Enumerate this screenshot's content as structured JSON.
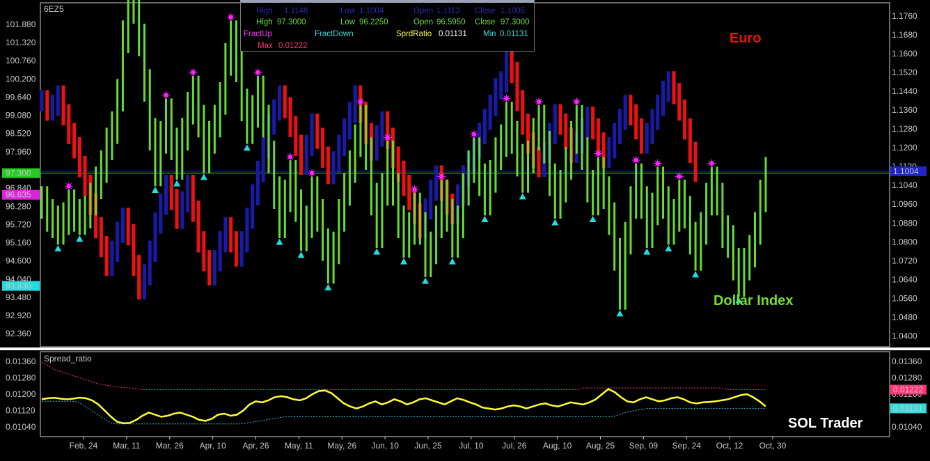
{
  "colors": {
    "background": "#000000",
    "frame": "#ffffff",
    "euro_up": "#1a1aa8",
    "euro_down": "#ee1111",
    "dx_bar": "#66dd33",
    "fract_up": "#ff22ff",
    "fract_down": "#22dddd",
    "spread_line": "#ffff33",
    "max_line": "#ff3377",
    "min_line": "#33bbdd",
    "hline_green": "#33dd33",
    "hline_blue": "#1f23c8"
  },
  "main_panel": {
    "symbol": "6EZ5",
    "series_labels": {
      "euro": "Euro",
      "dollar_index": "Dollar Index"
    },
    "left_axis_ticks": [
      "101.880",
      "101.320",
      "100.760",
      "100.200",
      "99.640",
      "99.080",
      "98.520",
      "97.960",
      "96.840",
      "96.280",
      "95.720",
      "95.160",
      "94.600",
      "94.040",
      "93.480",
      "92.920",
      "92.360"
    ],
    "right_axis_ticks": [
      "1.1760",
      "1.1680",
      "1.1600",
      "1.1520",
      "1.1440",
      "1.1360",
      "1.1280",
      "1.1200",
      "1.1120",
      "1.1040",
      "1.0960",
      "1.0880",
      "1.0800",
      "1.0720",
      "1.0640",
      "1.0560",
      "1.0480",
      "1.0400"
    ],
    "left_tags": [
      {
        "text": "97.300",
        "color": "#22cc22",
        "text_color": "#003300"
      },
      {
        "text": "96.635",
        "color": "#dd22dd",
        "text_color": "#330033"
      },
      {
        "text": "93.830",
        "color": "#22dddd",
        "text_color": "#003333"
      }
    ],
    "right_tags": [
      {
        "text": "1.1004",
        "color": "#1f23c8",
        "text_color": "#ffffff"
      }
    ]
  },
  "info_box": {
    "row1": {
      "high_label": "High",
      "high_value": "1.1148",
      "low_label": "Low",
      "low_value": "1.1004",
      "open_label": "Open",
      "open_value": "1.1113",
      "close_label": "Close",
      "close_value": "1.1005"
    },
    "row2": {
      "high_label": "High",
      "high_value": "97.3000",
      "low_label": "Low",
      "low_value": "96.2250",
      "open_label": "Open",
      "open_value": "96.5950",
      "close_label": "Close",
      "close_value": "97.3000"
    },
    "fract_up": "FractUp",
    "fract_down": "FractDown",
    "sprd_ratio_label": "SprdRatio",
    "sprd_ratio_value": "0.01131",
    "min_label": "Min",
    "min_value": "0.01131",
    "max_label": "Max",
    "max_value": "0.01222"
  },
  "lower_panel": {
    "title": "Spread_ratio",
    "left_axis_ticks": [
      "0.01360",
      "0.01280",
      "0.01200",
      "0.01120",
      "0.01040"
    ],
    "right_axis_ticks": [
      "0.01360",
      "0.01280",
      "0.01200",
      "0.01120",
      "0.01040"
    ],
    "right_tags": [
      {
        "text": "0.01222",
        "color": "#ff3377",
        "text_color": "#ffffff"
      },
      {
        "text": "0.01131",
        "color": "#33dddd",
        "text_color": "#002222"
      }
    ]
  },
  "x_axis_labels": [
    "Feb, 24",
    "Mar, 11",
    "Mar, 26",
    "Apr, 10",
    "Apr, 26",
    "May, 11",
    "May, 26",
    "Jun, 10",
    "Jun, 25",
    "Jul, 10",
    "Jul, 26",
    "Aug, 10",
    "Aug, 25",
    "Sep, 09",
    "Sep, 24",
    "Oct, 12",
    "Oct, 30"
  ],
  "watermark": "SOL Trader",
  "chart_data": [
    {
      "type": "bar",
      "title": "",
      "description_series": [
        "Euro",
        "Dollar Index"
      ],
      "ylim_left": [
        92.0,
        102.5
      ],
      "ylim_right": [
        1.036,
        1.181
      ],
      "series": [
        {
          "name": "Dollar Index",
          "values_close": [
            96.4,
            96.0,
            95.8,
            95.6,
            95.9,
            96.3,
            96.0,
            95.9,
            96.1,
            96.5,
            97.0,
            97.5,
            98.2,
            98.7,
            99.7,
            101.5,
            102.5,
            102.4,
            101.4,
            100.0,
            98.5,
            97.4,
            98.4,
            99.1,
            98.2,
            97.6,
            98.5,
            99.3,
            99.8,
            98.9,
            97.8,
            98.4,
            98.9,
            99.6,
            100.8,
            101.5,
            100.6,
            99.4,
            98.7,
            99.2,
            99.8,
            98.9,
            97.8,
            96.7,
            95.8,
            96.6,
            97.2,
            96.3,
            95.4,
            95.8,
            96.7,
            96.0,
            95.1,
            94.4,
            95.0,
            96.0,
            96.8,
            97.5,
            98.3,
            98.9,
            97.9,
            96.5,
            95.5,
            96.8,
            97.8,
            96.8,
            95.8,
            95.2,
            95.6,
            96.2,
            95.6,
            94.6,
            95.0,
            95.8,
            96.6,
            96.0,
            95.2,
            95.8,
            96.8,
            97.5,
            97.9,
            97.1,
            96.5,
            97.2,
            97.9,
            98.3,
            99.0,
            98.4,
            97.7,
            97.2,
            97.8,
            98.5,
            98.9,
            98.1,
            97.1,
            96.4,
            96.9,
            97.6,
            98.4,
            98.9,
            97.9,
            96.9,
            96.5,
            97.3,
            96.7,
            95.9,
            94.8,
            93.6,
            95.3,
            96.4,
            97.1,
            96.4,
            95.5,
            96.2,
            97.0,
            96.4,
            95.6,
            96.0,
            96.6,
            96.1,
            95.3,
            94.8,
            95.6,
            96.5,
            97.0,
            96.5,
            95.5,
            95.2,
            94.5,
            94.0,
            94.5,
            94.9,
            95.6,
            96.6,
            97.3
          ],
          "fractals_up_x": [
            "Feb, 24",
            "Mar, 11",
            "Mar, 26",
            "Apr, 10",
            "Apr, 26",
            "May, 11",
            "May, 26",
            "Jun, 10",
            "Jun, 25",
            "Jul, 10",
            "Jul, 26",
            "Aug, 10",
            "Aug, 25",
            "Sep, 09",
            "Sep, 24",
            "Oct, 12"
          ],
          "fractals_down_x": [
            "Feb, 24",
            "Mar, 11",
            "Mar, 26",
            "Apr, 10",
            "Apr, 26",
            "May, 11",
            "May, 26",
            "Jun, 10",
            "Jun, 25",
            "Jul, 10",
            "Jul, 26",
            "Aug, 10",
            "Aug, 25",
            "Sep, 09",
            "Sep, 24",
            "Oct, 12"
          ]
        },
        {
          "name": "Euro",
          "values_close": [
            1.14,
            1.136,
            1.138,
            1.142,
            1.134,
            1.126,
            1.12,
            1.112,
            1.104,
            1.096,
            1.086,
            1.078,
            1.07,
            1.076,
            1.084,
            1.09,
            1.083,
            1.07,
            1.06,
            1.066,
            1.076,
            1.088,
            1.096,
            1.104,
            1.098,
            1.09,
            1.097,
            1.104,
            1.093,
            1.08,
            1.072,
            1.066,
            1.072,
            1.08,
            1.086,
            1.08,
            1.074,
            1.08,
            1.09,
            1.1,
            1.11,
            1.12,
            1.13,
            1.136,
            1.142,
            1.137,
            1.129,
            1.121,
            1.113,
            1.121,
            1.13,
            1.124,
            1.116,
            1.109,
            1.114,
            1.121,
            1.128,
            1.135,
            1.142,
            1.135,
            1.126,
            1.119,
            1.125,
            1.131,
            1.124,
            1.116,
            1.11,
            1.104,
            1.098,
            1.092,
            1.086,
            1.094,
            1.102,
            1.108,
            1.102,
            1.096,
            1.092,
            1.1,
            1.108,
            1.114,
            1.12,
            1.126,
            1.132,
            1.138,
            1.145,
            1.148,
            1.168,
            1.152,
            1.14,
            1.13,
            1.122,
            1.116,
            1.112,
            1.118,
            1.126,
            1.134,
            1.13,
            1.124,
            1.118,
            1.122,
            1.128,
            1.133,
            1.128,
            1.122,
            1.116,
            1.12,
            1.126,
            1.132,
            1.138,
            1.134,
            1.128,
            1.122,
            1.126,
            1.132,
            1.138,
            1.144,
            1.148,
            1.143,
            1.136,
            1.128,
            1.118,
            1.11
          ]
        }
      ]
    },
    {
      "type": "line",
      "title": "Spread_ratio",
      "ylim": [
        0.01,
        0.014
      ],
      "series": [
        {
          "name": "SprdRatio",
          "values": [
            0.01175,
            0.0118,
            0.01182,
            0.01178,
            0.01175,
            0.01178,
            0.01183,
            0.0118,
            0.0117,
            0.0115,
            0.0112,
            0.0109,
            0.01065,
            0.01058,
            0.0106,
            0.01075,
            0.01095,
            0.0111,
            0.011,
            0.0109,
            0.01095,
            0.01105,
            0.0111,
            0.011,
            0.0109,
            0.01075,
            0.0107,
            0.0108,
            0.011,
            0.01105,
            0.01095,
            0.011,
            0.0112,
            0.0115,
            0.01165,
            0.0116,
            0.0117,
            0.01185,
            0.0119,
            0.01185,
            0.01175,
            0.0117,
            0.0118,
            0.012,
            0.01215,
            0.01218,
            0.01205,
            0.0118,
            0.01155,
            0.0114,
            0.0113,
            0.0114,
            0.01155,
            0.01165,
            0.0115,
            0.0116,
            0.01175,
            0.01165,
            0.0115,
            0.0116,
            0.01175,
            0.0118,
            0.0117,
            0.0116,
            0.0115,
            0.01165,
            0.0118,
            0.01172,
            0.0116,
            0.0115,
            0.01135,
            0.0113,
            0.01125,
            0.0113,
            0.0114,
            0.01145,
            0.0114,
            0.0113,
            0.0114,
            0.0115,
            0.01155,
            0.01145,
            0.0114,
            0.0115,
            0.0116,
            0.01155,
            0.0115,
            0.0116,
            0.01175,
            0.012,
            0.01225,
            0.0121,
            0.01185,
            0.01165,
            0.0116,
            0.01175,
            0.01185,
            0.01175,
            0.01165,
            0.0117,
            0.0118,
            0.01185,
            0.01175,
            0.0116,
            0.01155,
            0.0116,
            0.01162,
            0.01165,
            0.0117,
            0.01175,
            0.01185,
            0.01195,
            0.012,
            0.01185,
            0.01165,
            0.0114
          ]
        },
        {
          "name": "Max",
          "values": [
            0.01355,
            0.0134,
            0.0132,
            0.0131,
            0.013,
            0.0129,
            0.0128,
            0.0127,
            0.0126,
            0.0125,
            0.01245,
            0.0124,
            0.01235,
            0.01232,
            0.0123,
            0.01226,
            0.01222,
            0.01222,
            0.01222,
            0.01222,
            0.01222,
            0.01222,
            0.01222,
            0.01222,
            0.01222,
            0.01222,
            0.01222,
            0.01222,
            0.01222,
            0.01222,
            0.01222,
            0.01222,
            0.01222,
            0.01222,
            0.01222,
            0.01222,
            0.01222,
            0.01222,
            0.01222,
            0.01222,
            0.01222,
            0.01222,
            0.01222,
            0.01222,
            0.01222,
            0.01222,
            0.01222,
            0.01222,
            0.01222,
            0.01222,
            0.01222,
            0.01222,
            0.01222,
            0.01222,
            0.01222,
            0.01222,
            0.01222,
            0.01222,
            0.01222,
            0.01222,
            0.01222,
            0.01222,
            0.01222,
            0.01222,
            0.01222,
            0.01222,
            0.01222,
            0.01222,
            0.01222,
            0.01222,
            0.01222,
            0.01222,
            0.01222,
            0.01222,
            0.01222,
            0.01222,
            0.01222,
            0.01222,
            0.01222,
            0.01222,
            0.01222,
            0.01222,
            0.01222,
            0.01222,
            0.01222,
            0.01222,
            0.0123,
            0.0123,
            0.0123,
            0.0123,
            0.0123,
            0.0123,
            0.0123,
            0.0123,
            0.0123,
            0.0123,
            0.0123,
            0.0123,
            0.0123,
            0.0123,
            0.0123,
            0.0123,
            0.0123,
            0.0123,
            0.0123,
            0.0123,
            0.0123,
            0.0123,
            0.0123,
            0.01222,
            0.01222,
            0.01222,
            0.01222,
            0.01222,
            0.01222,
            0.01222
          ]
        },
        {
          "name": "Min",
          "values": [
            0.01165,
            0.01165,
            0.01165,
            0.01165,
            0.01165,
            0.01165,
            0.0116,
            0.0114,
            0.0112,
            0.011,
            0.0108,
            0.0106,
            0.01055,
            0.01055,
            0.01055,
            0.01055,
            0.01055,
            0.01055,
            0.01055,
            0.01055,
            0.01055,
            0.01055,
            0.01055,
            0.01055,
            0.01055,
            0.01055,
            0.01055,
            0.01055,
            0.01055,
            0.01055,
            0.01055,
            0.01055,
            0.01055,
            0.0106,
            0.01065,
            0.0107,
            0.01075,
            0.0108,
            0.01085,
            0.0109,
            0.0109,
            0.0109,
            0.0109,
            0.0109,
            0.0109,
            0.0109,
            0.0109,
            0.0109,
            0.0109,
            0.0109,
            0.0109,
            0.0109,
            0.0109,
            0.0109,
            0.0109,
            0.0109,
            0.0109,
            0.0109,
            0.0109,
            0.0109,
            0.0109,
            0.0109,
            0.0109,
            0.0109,
            0.0109,
            0.0109,
            0.0109,
            0.0109,
            0.0109,
            0.0109,
            0.0109,
            0.0109,
            0.0109,
            0.0109,
            0.0109,
            0.0109,
            0.0109,
            0.0109,
            0.0109,
            0.0109,
            0.0109,
            0.0109,
            0.0109,
            0.0109,
            0.0109,
            0.0109,
            0.0109,
            0.0109,
            0.0109,
            0.0109,
            0.0109,
            0.0109,
            0.01095,
            0.01105,
            0.01115,
            0.0112,
            0.01125,
            0.0113,
            0.01131,
            0.01131,
            0.01131,
            0.01131,
            0.01131,
            0.01131,
            0.01131,
            0.01131,
            0.01131,
            0.01131,
            0.01131,
            0.01131,
            0.01131,
            0.01131,
            0.01131,
            0.01131,
            0.01131,
            0.01131,
            0.01131
          ]
        }
      ]
    }
  ]
}
